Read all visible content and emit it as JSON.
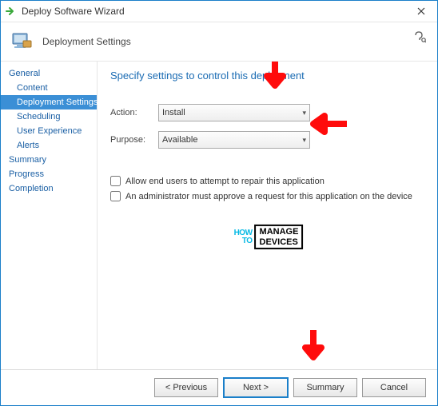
{
  "window": {
    "title": "Deploy Software Wizard"
  },
  "header": {
    "title": "Deployment Settings"
  },
  "sidebar": {
    "items": [
      {
        "label": "General",
        "sub": false,
        "sel": false
      },
      {
        "label": "Content",
        "sub": true,
        "sel": false
      },
      {
        "label": "Deployment Settings",
        "sub": true,
        "sel": true
      },
      {
        "label": "Scheduling",
        "sub": true,
        "sel": false
      },
      {
        "label": "User Experience",
        "sub": true,
        "sel": false
      },
      {
        "label": "Alerts",
        "sub": true,
        "sel": false
      },
      {
        "label": "Summary",
        "sub": false,
        "sel": false
      },
      {
        "label": "Progress",
        "sub": false,
        "sel": false
      },
      {
        "label": "Completion",
        "sub": false,
        "sel": false
      }
    ]
  },
  "page": {
    "heading": "Specify settings to control this deployment",
    "action_label": "Action:",
    "action_value": "Install",
    "purpose_label": "Purpose:",
    "purpose_value": "Available",
    "check_repair": "Allow end users to attempt to repair this application",
    "check_approve": "An administrator must approve a request for this application on the device"
  },
  "footer": {
    "previous": "< Previous",
    "next": "Next >",
    "summary": "Summary",
    "cancel": "Cancel"
  },
  "watermark": {
    "left_top": "HOW",
    "left_bottom": "TO",
    "right_top": "MANAGE",
    "right_bottom": "DEVICES"
  },
  "colors": {
    "accent": "#1a7fc9",
    "link": "#1a5fa4",
    "arrow": "#ff0b0b"
  }
}
